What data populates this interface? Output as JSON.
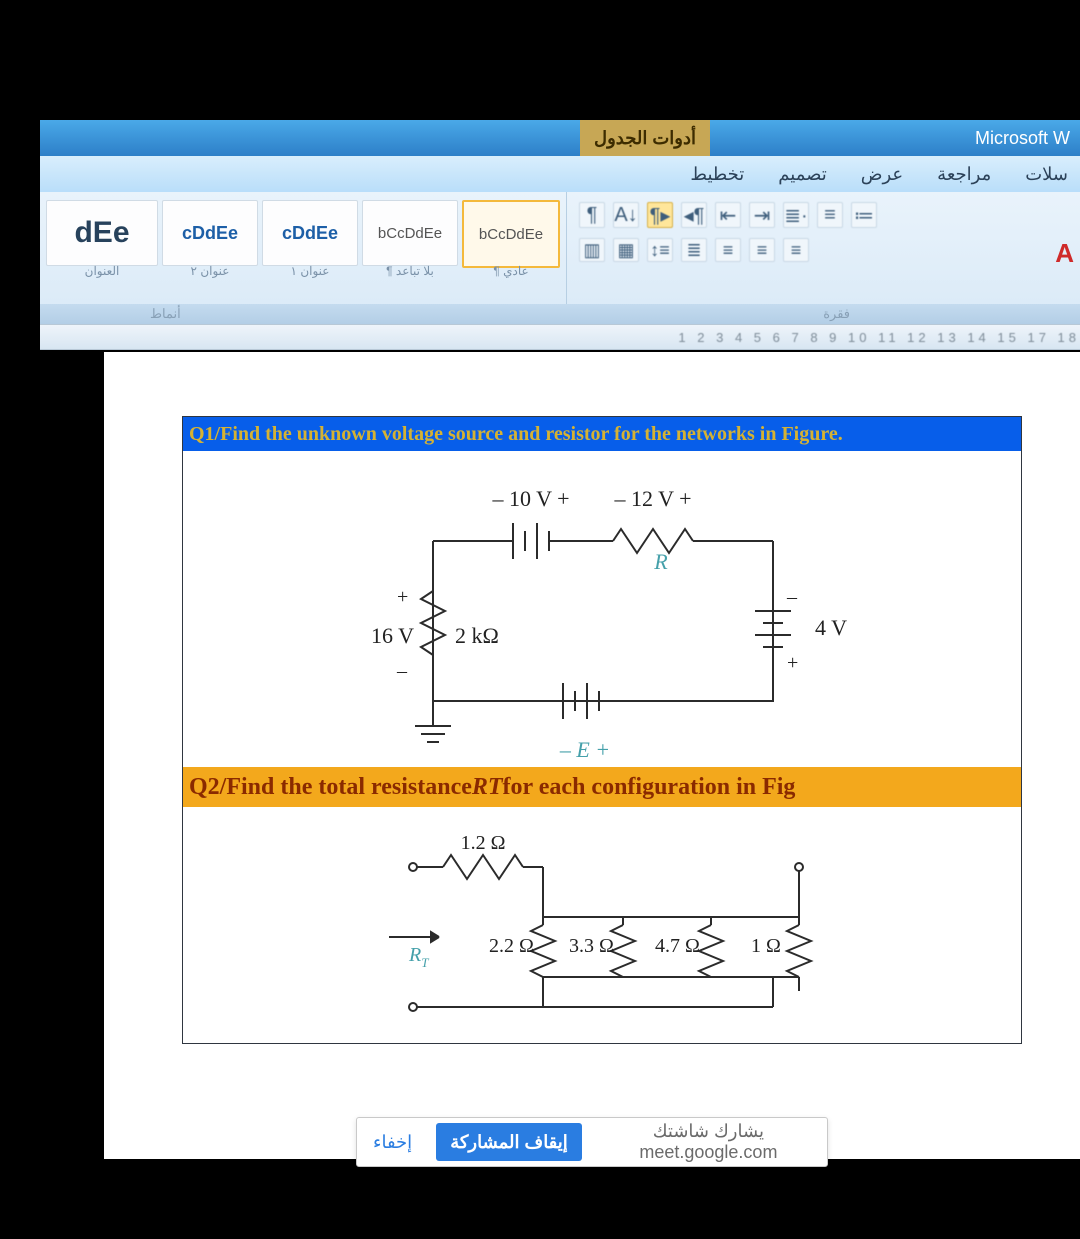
{
  "title": {
    "brand": "Microsoft W",
    "table_tools": "أدوات الجدول"
  },
  "tabs": {
    "layout": "تخطيط",
    "design": "تصميم",
    "view": "عرض",
    "review": "مراجعة",
    "mail": "سلات"
  },
  "styles": {
    "s1": "dEe",
    "s2": "cDdEe",
    "s3": "cDdEe",
    "s4": "bCcDdEe",
    "s5": "bCcDdEe",
    "c1": "العنوان",
    "c2": "عنوان ٢",
    "c3": "عنوان ١",
    "c4": "¶ بلا تباعد",
    "c5": "¶ عادي"
  },
  "group": {
    "left": "أنماط",
    "right": "فقرة"
  },
  "ruler": "  1     2     3     4     5     6     7     8     9     10     11     12     13     14     15            17   18",
  "q1": {
    "title": "Q1/Find the unknown voltage source and resistor for the networks in Figure.",
    "v10": "– 10 V +",
    "v12": "– 12 V +",
    "R": "R",
    "p16": "16 V",
    "r2k": "2 kΩ",
    "v4": "4 V",
    "E": "–   E   +",
    "plus": "+",
    "minus": "–",
    "plus2": "+",
    "minus2": "–"
  },
  "q2": {
    "title_a": "Q2/Find the total resistance ",
    "title_b": "RT",
    "title_c": " for each configuration in Fig",
    "r12": "1.2 Ω",
    "r22": "2.2 Ω",
    "r33": "3.3 Ω",
    "r47": "4.7 Ω",
    "r1": "1 Ω",
    "rt": "R",
    "rtsub": "T"
  },
  "share": {
    "hide": "إخفاء",
    "stop": "إيقاف المشاركة",
    "msg": "يشارك شاشتك meet.google.com"
  }
}
